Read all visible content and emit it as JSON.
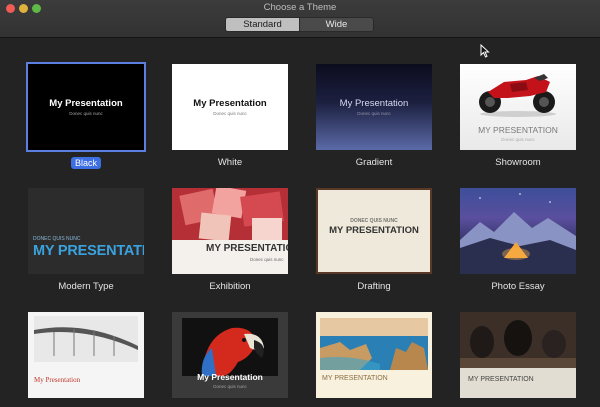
{
  "window": {
    "title": "Choose a Theme"
  },
  "tabs": [
    {
      "label": "Standard",
      "active": true
    },
    {
      "label": "Wide",
      "active": false
    }
  ],
  "themes": [
    {
      "name": "Black",
      "selected": true,
      "title": "My Presentation",
      "subtitle": "Donec quis nunc"
    },
    {
      "name": "White",
      "title": "My Presentation",
      "subtitle": "Donec quis nunc"
    },
    {
      "name": "Gradient",
      "title": "My Presentation",
      "subtitle": "Donec quis nunc"
    },
    {
      "name": "Showroom",
      "title": "MY PRESENTATION",
      "subtitle": "Donec quis nunc"
    },
    {
      "name": "Modern Type",
      "title": "MY PRESENTATION",
      "kicker": "DONEC QUIS NUNC"
    },
    {
      "name": "Exhibition",
      "title": "MY PRESENTATION",
      "subtitle": "Donec quis nunc"
    },
    {
      "name": "Drafting",
      "title": "MY PRESENTATION",
      "kicker": "DONEC QUIS NUNC"
    },
    {
      "name": "Photo Essay"
    },
    {
      "name": "",
      "title": "My Presentation"
    },
    {
      "name": "",
      "title": "My Presentation",
      "subtitle": "Donec quis nunc"
    },
    {
      "name": "",
      "title": "MY PRESENTATION"
    },
    {
      "name": "",
      "title": "MY PRESENTATION"
    }
  ],
  "colors": {
    "accent": "#3d6ee2",
    "window_bg": "#232323"
  }
}
